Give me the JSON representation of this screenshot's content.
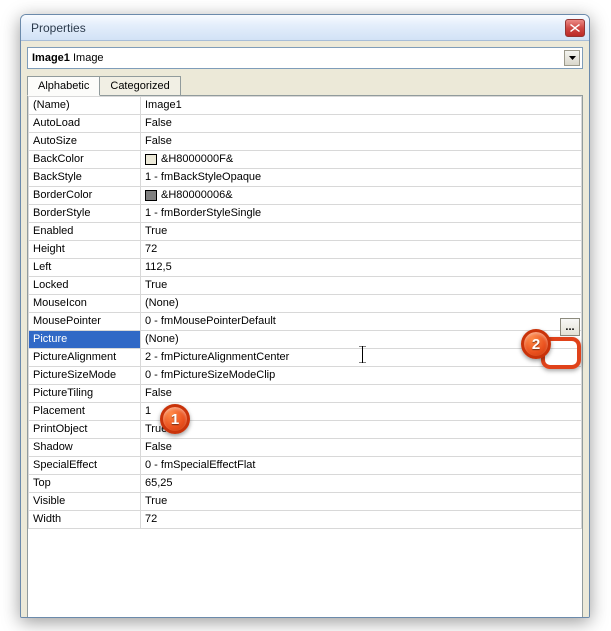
{
  "window": {
    "title": "Properties"
  },
  "dropdown": {
    "bold": "Image1",
    "rest": " Image"
  },
  "tabs": {
    "alphabetic": "Alphabetic",
    "categorized": "Categorized"
  },
  "props": [
    {
      "name": "(Name)",
      "value": "Image1"
    },
    {
      "name": "AutoLoad",
      "value": "False"
    },
    {
      "name": "AutoSize",
      "value": "False"
    },
    {
      "name": "BackColor",
      "value": "&H8000000F&",
      "swatch": "#ece9d8"
    },
    {
      "name": "BackStyle",
      "value": "1 - fmBackStyleOpaque"
    },
    {
      "name": "BorderColor",
      "value": "&H80000006&",
      "swatch": "#808080"
    },
    {
      "name": "BorderStyle",
      "value": "1 - fmBorderStyleSingle"
    },
    {
      "name": "Enabled",
      "value": "True"
    },
    {
      "name": "Height",
      "value": "72"
    },
    {
      "name": "Left",
      "value": "112,5"
    },
    {
      "name": "Locked",
      "value": "True"
    },
    {
      "name": "MouseIcon",
      "value": "(None)"
    },
    {
      "name": "MousePointer",
      "value": "0 - fmMousePointerDefault"
    },
    {
      "name": "Picture",
      "value": "(None)",
      "selected": true
    },
    {
      "name": "PictureAlignment",
      "value": "2 - fmPictureAlignmentCenter"
    },
    {
      "name": "PictureSizeMode",
      "value": "0 - fmPictureSizeModeClip"
    },
    {
      "name": "PictureTiling",
      "value": "False"
    },
    {
      "name": "Placement",
      "value": "1"
    },
    {
      "name": "PrintObject",
      "value": "True"
    },
    {
      "name": "Shadow",
      "value": "False"
    },
    {
      "name": "SpecialEffect",
      "value": "0 - fmSpecialEffectFlat"
    },
    {
      "name": "Top",
      "value": "65,25"
    },
    {
      "name": "Visible",
      "value": "True"
    },
    {
      "name": "Width",
      "value": "72"
    }
  ],
  "ellipsis": "...",
  "markers": {
    "one": "1",
    "two": "2"
  }
}
